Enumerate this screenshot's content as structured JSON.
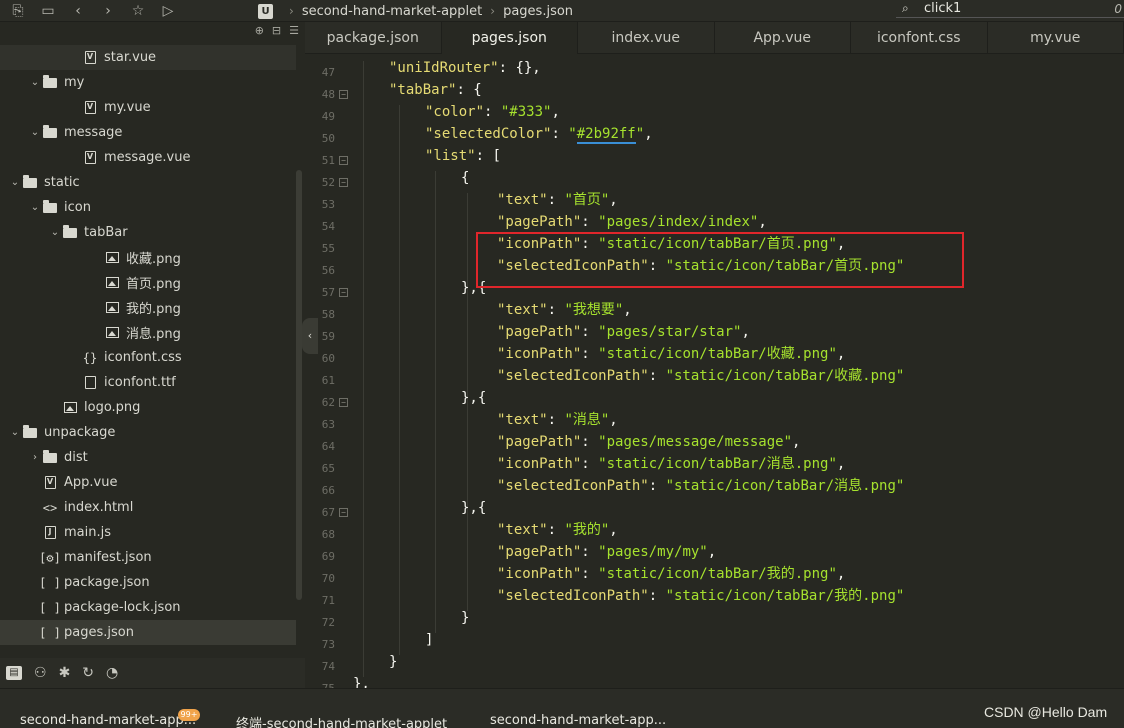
{
  "toolbar": {
    "icons": [
      "new-file-icon",
      "save-icon",
      "back-icon",
      "forward-icon",
      "star-icon",
      "run-icon"
    ],
    "breadcrumb": [
      "second-hand-market-applet",
      "pages.json"
    ],
    "search_value": "click1",
    "search_right": "0"
  },
  "sidebar": {
    "tree": [
      {
        "label": "star.vue",
        "type": "vue",
        "depth": 4,
        "state": "hl"
      },
      {
        "label": "my",
        "type": "folder",
        "depth": 2
      },
      {
        "label": "my.vue",
        "type": "vue",
        "depth": 4
      },
      {
        "label": "message",
        "type": "folder",
        "depth": 2
      },
      {
        "label": "message.vue",
        "type": "vue",
        "depth": 4
      },
      {
        "label": "static",
        "type": "folder",
        "depth": 1
      },
      {
        "label": "icon",
        "type": "folder",
        "depth": 2
      },
      {
        "label": "tabBar",
        "type": "folder",
        "depth": 3
      },
      {
        "label": "收藏.png",
        "type": "image",
        "depth": 5
      },
      {
        "label": "首页.png",
        "type": "image",
        "depth": 5
      },
      {
        "label": "我的.png",
        "type": "image",
        "depth": 5
      },
      {
        "label": "消息.png",
        "type": "image",
        "depth": 5
      },
      {
        "label": "iconfont.css",
        "type": "css",
        "depth": 4
      },
      {
        "label": "iconfont.ttf",
        "type": "file",
        "depth": 4
      },
      {
        "label": "logo.png",
        "type": "image",
        "depth": 3
      },
      {
        "label": "unpackage",
        "type": "folder",
        "depth": 1
      },
      {
        "label": "dist",
        "type": "folder-closed",
        "depth": 2
      },
      {
        "label": "App.vue",
        "type": "vue",
        "depth": 2
      },
      {
        "label": "index.html",
        "type": "html",
        "depth": 2
      },
      {
        "label": "main.js",
        "type": "js",
        "depth": 2
      },
      {
        "label": "manifest.json",
        "type": "manifest",
        "depth": 2
      },
      {
        "label": "package.json",
        "type": "json",
        "depth": 2
      },
      {
        "label": "package-lock.json",
        "type": "json",
        "depth": 2
      },
      {
        "label": "pages.json",
        "type": "json",
        "depth": 2,
        "state": "sel"
      }
    ]
  },
  "tabs": [
    "package.json",
    "pages.json",
    "index.vue",
    "App.vue",
    "iconfont.css",
    "my.vue"
  ],
  "active_tab": "pages.json",
  "code": {
    "line_numbers": [
      "47",
      "48",
      "49",
      "50",
      "51",
      "52",
      "53",
      "54",
      "55",
      "56",
      "57",
      "58",
      "59",
      "60",
      "61",
      "62",
      "63",
      "64",
      "65",
      "66",
      "67",
      "68",
      "69",
      "70",
      "71",
      "72",
      "73",
      "74",
      "75"
    ],
    "lines": [
      "\"uniIdRouter\": {},",
      "\"tabBar\": {",
      "\"color\": \"#333\",",
      "\"selectedColor\": \"#2b92ff\",",
      "\"list\": [",
      "{",
      "\"text\": \"首页\",",
      "\"pagePath\": \"pages/index/index\",",
      "\"iconPath\": \"static/icon/tabBar/首页.png\",",
      "\"selectedIconPath\": \"static/icon/tabBar/首页.png\"",
      "},{",
      "\"text\": \"我想要\",",
      "\"pagePath\": \"pages/star/star\",",
      "\"iconPath\": \"static/icon/tabBar/收藏.png\",",
      "\"selectedIconPath\": \"static/icon/tabBar/收藏.png\"",
      "},{",
      "\"text\": \"消息\",",
      "\"pagePath\": \"pages/message/message\",",
      "\"iconPath\": \"static/icon/tabBar/消息.png\",",
      "\"selectedIconPath\": \"static/icon/tabBar/消息.png\"",
      "},{",
      "\"text\": \"我的\",",
      "\"pagePath\": \"pages/my/my\",",
      "\"iconPath\": \"static/icon/tabBar/我的.png\",",
      "\"selectedIconPath\": \"static/icon/tabBar/我的.png\"",
      "}",
      "]",
      "}",
      "},"
    ]
  },
  "statusbar": {
    "items": [
      "second-hand-market-app...",
      "终端-second-hand-market-applet",
      "second-hand-market-app..."
    ],
    "badge": "99+",
    "watermark": "CSDN @Hello Dam"
  }
}
